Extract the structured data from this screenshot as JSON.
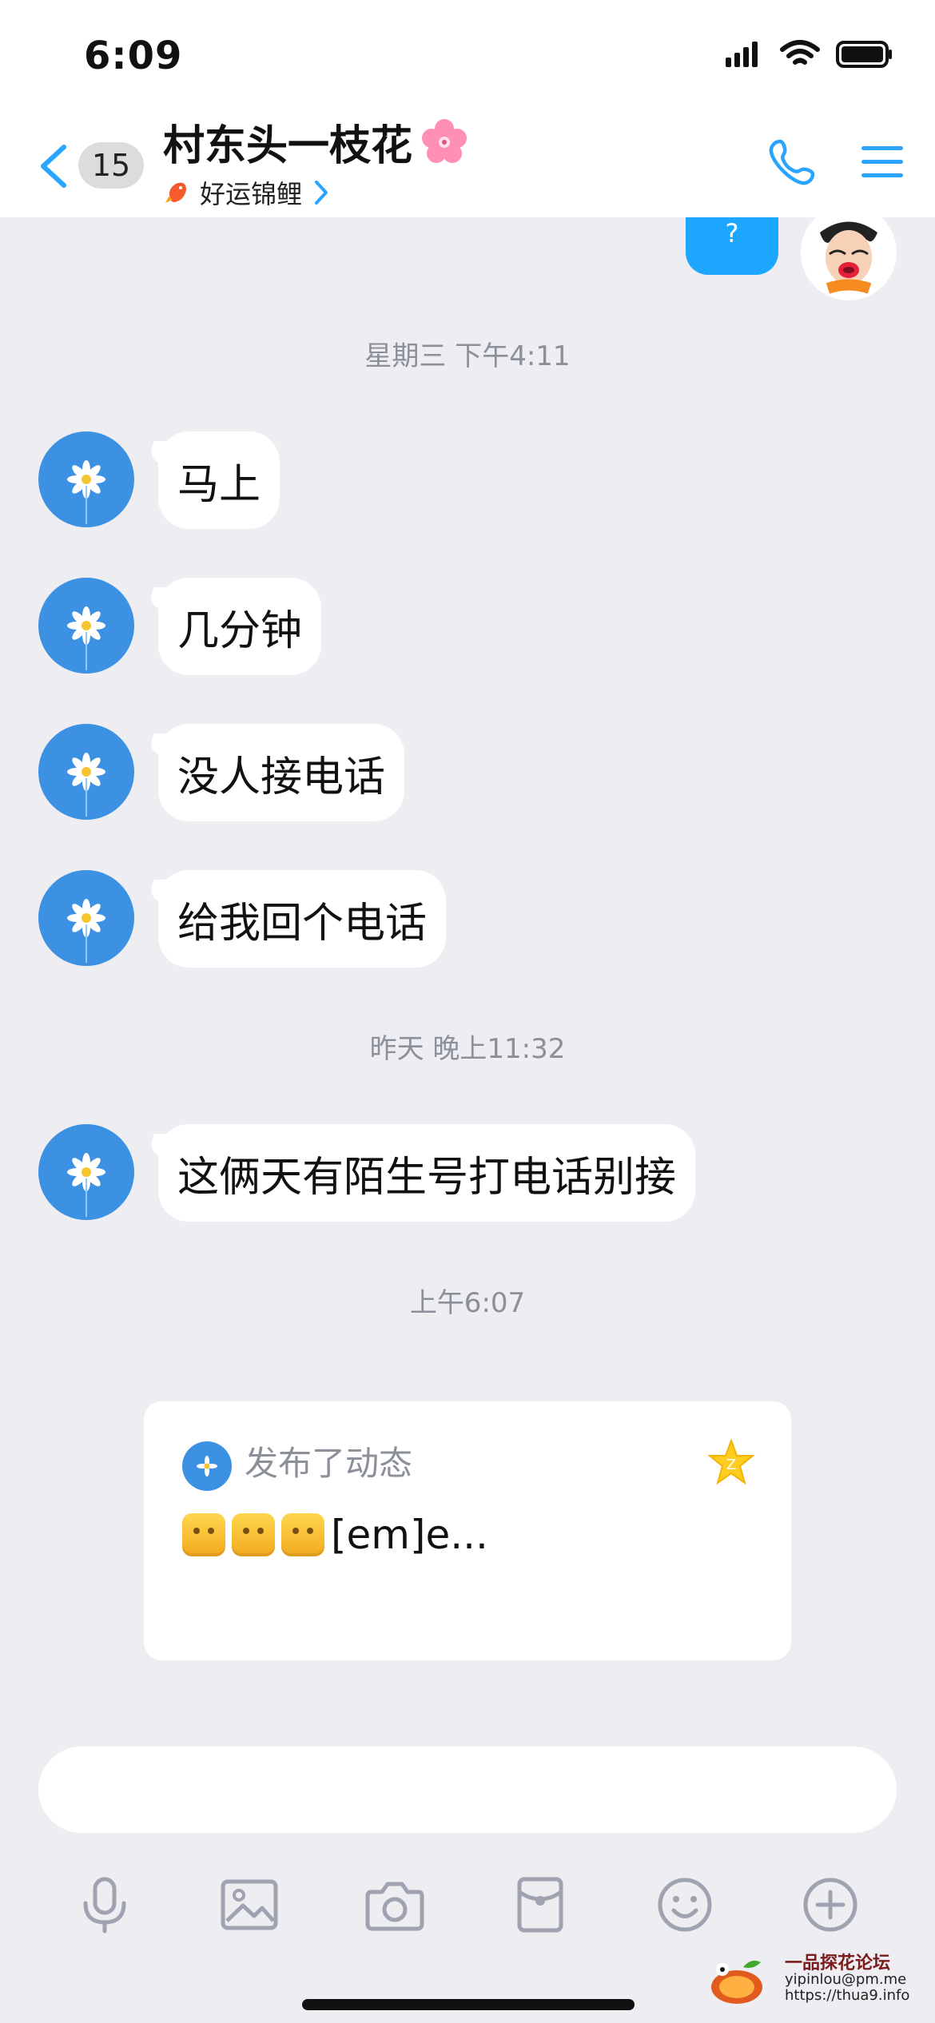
{
  "status_bar": {
    "time": "6:09"
  },
  "header": {
    "unread_count": "15",
    "title": "村东头一枝花",
    "subtitle": "好运锦鲤"
  },
  "chat": {
    "top_bubble_text": "?",
    "timestamps": [
      "星期三 下午4:11",
      "昨天 晚上11:32",
      "上午6:07"
    ],
    "messages": [
      "马上",
      "几分钟",
      "没人接电话",
      "给我回个电话",
      "这俩天有陌生号打电话别接"
    ],
    "feed": {
      "title": "发布了动态",
      "content_suffix": "[em]e..."
    }
  },
  "input": {
    "value": "",
    "placeholder": ""
  },
  "toolbar": {
    "icons": [
      "microphone-icon",
      "image-icon",
      "camera-icon",
      "red-packet-icon",
      "emoji-icon",
      "plus-icon"
    ]
  },
  "watermark": {
    "line1": "一品探花论坛",
    "line2": "yipinlou@pm.me",
    "line3": "https://thua9.info"
  },
  "colors": {
    "accent_blue": "#1ea7ff",
    "avatar_blue": "#3d91e2",
    "background": "#ededf2"
  }
}
